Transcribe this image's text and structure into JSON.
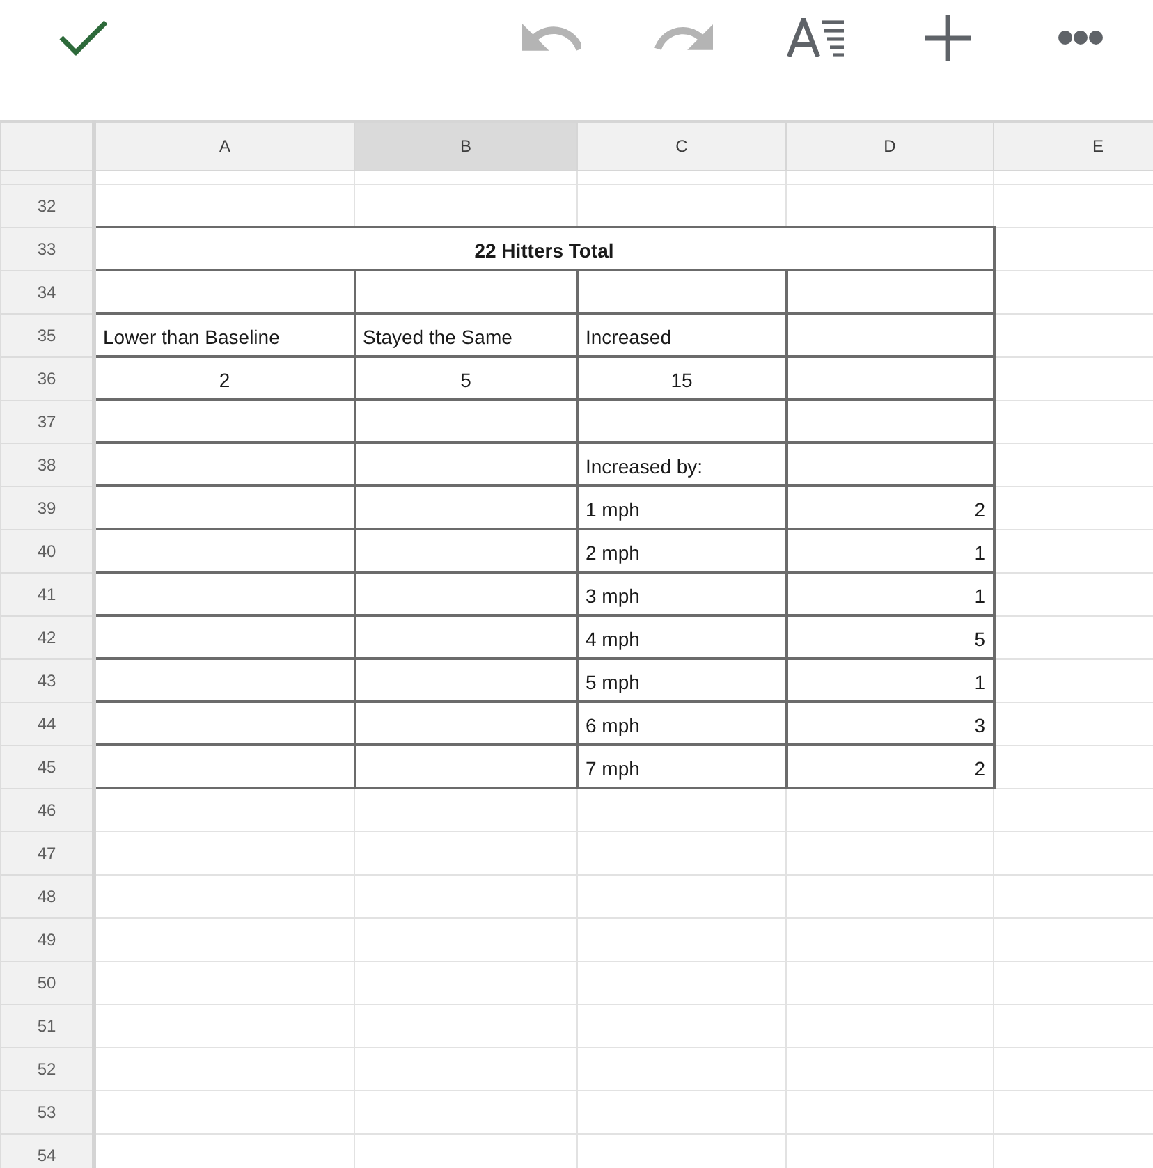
{
  "toolbar": {
    "left": [
      {
        "kind": "check",
        "disabled": false
      }
    ],
    "right": [
      {
        "kind": "undo",
        "disabled": true
      },
      {
        "kind": "redo",
        "disabled": true
      },
      {
        "kind": "text_format",
        "disabled": false
      },
      {
        "kind": "add",
        "disabled": false
      },
      {
        "kind": "more",
        "disabled": false
      }
    ]
  },
  "columns": [
    {
      "label": "A",
      "selected": false
    },
    {
      "label": "B",
      "selected": true
    },
    {
      "label": "C",
      "selected": false
    },
    {
      "label": "D",
      "selected": false
    },
    {
      "label": "E",
      "selected": false
    }
  ],
  "rows": [
    {
      "number": "32",
      "cells": [
        {
          "kind": "empty",
          "bordered": false
        },
        {
          "kind": "empty",
          "bordered": false
        },
        {
          "kind": "empty",
          "bordered": false
        },
        {
          "kind": "empty",
          "bordered": false
        },
        {
          "kind": "empty",
          "bordered": false
        }
      ]
    },
    {
      "number": "33",
      "cells": [
        {
          "kind": "title",
          "text": "22 Hitters Total",
          "bordered": true
        },
        {
          "kind": "empty",
          "bordered": false
        }
      ]
    },
    {
      "number": "34",
      "cells": [
        {
          "kind": "empty",
          "bordered": true
        },
        {
          "kind": "empty",
          "bordered": true
        },
        {
          "kind": "empty",
          "bordered": true
        },
        {
          "kind": "empty",
          "bordered": true
        },
        {
          "kind": "empty",
          "bordered": false
        }
      ]
    },
    {
      "number": "35",
      "cells": [
        {
          "kind": "label",
          "text": "Lower than Baseline",
          "bordered": true
        },
        {
          "kind": "label",
          "text": "Stayed the Same",
          "bordered": true
        },
        {
          "kind": "label",
          "text": "Increased",
          "bordered": true
        },
        {
          "kind": "empty",
          "bordered": true
        },
        {
          "kind": "empty",
          "bordered": false
        }
      ]
    },
    {
      "number": "36",
      "cells": [
        {
          "kind": "total",
          "text": "2",
          "bordered": true
        },
        {
          "kind": "total",
          "text": "5",
          "bordered": true
        },
        {
          "kind": "total",
          "text": "15",
          "bordered": true
        },
        {
          "kind": "empty",
          "bordered": true
        },
        {
          "kind": "empty",
          "bordered": false
        }
      ]
    },
    {
      "number": "37",
      "cells": [
        {
          "kind": "empty",
          "bordered": true
        },
        {
          "kind": "empty",
          "bordered": true
        },
        {
          "kind": "empty",
          "bordered": true
        },
        {
          "kind": "empty",
          "bordered": true
        },
        {
          "kind": "empty",
          "bordered": false
        }
      ]
    },
    {
      "number": "38",
      "cells": [
        {
          "kind": "empty",
          "bordered": true
        },
        {
          "kind": "empty",
          "bordered": true
        },
        {
          "kind": "label",
          "text": "Increased by:",
          "bordered": true
        },
        {
          "kind": "empty",
          "bordered": true
        },
        {
          "kind": "empty",
          "bordered": false
        }
      ]
    },
    {
      "number": "39",
      "cells": [
        {
          "kind": "empty",
          "bordered": true
        },
        {
          "kind": "empty",
          "bordered": true
        },
        {
          "kind": "label",
          "text": "1 mph",
          "bordered": true
        },
        {
          "kind": "count",
          "text": "2",
          "bordered": true
        },
        {
          "kind": "empty",
          "bordered": false
        }
      ]
    },
    {
      "number": "40",
      "cells": [
        {
          "kind": "empty",
          "bordered": true
        },
        {
          "kind": "empty",
          "bordered": true
        },
        {
          "kind": "label",
          "text": "2 mph",
          "bordered": true
        },
        {
          "kind": "count",
          "text": "1",
          "bordered": true
        },
        {
          "kind": "empty",
          "bordered": false
        }
      ]
    },
    {
      "number": "41",
      "cells": [
        {
          "kind": "empty",
          "bordered": true
        },
        {
          "kind": "empty",
          "bordered": true
        },
        {
          "kind": "label",
          "text": "3 mph",
          "bordered": true
        },
        {
          "kind": "count",
          "text": "1",
          "bordered": true
        },
        {
          "kind": "empty",
          "bordered": false
        }
      ]
    },
    {
      "number": "42",
      "cells": [
        {
          "kind": "empty",
          "bordered": true
        },
        {
          "kind": "empty",
          "bordered": true
        },
        {
          "kind": "label",
          "text": "4 mph",
          "bordered": true
        },
        {
          "kind": "count",
          "text": "5",
          "bordered": true
        },
        {
          "kind": "empty",
          "bordered": false
        }
      ]
    },
    {
      "number": "43",
      "cells": [
        {
          "kind": "empty",
          "bordered": true
        },
        {
          "kind": "empty",
          "bordered": true
        },
        {
          "kind": "label",
          "text": "5 mph",
          "bordered": true
        },
        {
          "kind": "count",
          "text": "1",
          "bordered": true
        },
        {
          "kind": "empty",
          "bordered": false
        }
      ]
    },
    {
      "number": "44",
      "cells": [
        {
          "kind": "empty",
          "bordered": true
        },
        {
          "kind": "empty",
          "bordered": true
        },
        {
          "kind": "label",
          "text": "6 mph",
          "bordered": true
        },
        {
          "kind": "count",
          "text": "3",
          "bordered": true
        },
        {
          "kind": "empty",
          "bordered": false
        }
      ]
    },
    {
      "number": "45",
      "cells": [
        {
          "kind": "empty",
          "bordered": true
        },
        {
          "kind": "empty",
          "bordered": true
        },
        {
          "kind": "label",
          "text": "7 mph",
          "bordered": true
        },
        {
          "kind": "count",
          "text": "2",
          "bordered": true
        },
        {
          "kind": "empty",
          "bordered": false
        }
      ]
    },
    {
      "number": "46",
      "cells": [
        {
          "kind": "empty",
          "bordered": false
        },
        {
          "kind": "empty",
          "bordered": false
        },
        {
          "kind": "empty",
          "bordered": false
        },
        {
          "kind": "empty",
          "bordered": false
        },
        {
          "kind": "empty",
          "bordered": false
        }
      ]
    },
    {
      "number": "47",
      "cells": [
        {
          "kind": "empty",
          "bordered": false
        },
        {
          "kind": "empty",
          "bordered": false
        },
        {
          "kind": "empty",
          "bordered": false
        },
        {
          "kind": "empty",
          "bordered": false
        },
        {
          "kind": "empty",
          "bordered": false
        }
      ]
    },
    {
      "number": "48",
      "cells": [
        {
          "kind": "empty",
          "bordered": false
        },
        {
          "kind": "empty",
          "bordered": false
        },
        {
          "kind": "empty",
          "bordered": false
        },
        {
          "kind": "empty",
          "bordered": false
        },
        {
          "kind": "empty",
          "bordered": false
        }
      ]
    },
    {
      "number": "49",
      "cells": [
        {
          "kind": "empty",
          "bordered": false
        },
        {
          "kind": "empty",
          "bordered": false
        },
        {
          "kind": "empty",
          "bordered": false
        },
        {
          "kind": "empty",
          "bordered": false
        },
        {
          "kind": "empty",
          "bordered": false
        }
      ]
    },
    {
      "number": "50",
      "cells": [
        {
          "kind": "empty",
          "bordered": false
        },
        {
          "kind": "empty",
          "bordered": false
        },
        {
          "kind": "empty",
          "bordered": false
        },
        {
          "kind": "empty",
          "bordered": false
        },
        {
          "kind": "empty",
          "bordered": false
        }
      ]
    },
    {
      "number": "51",
      "cells": [
        {
          "kind": "empty",
          "bordered": false
        },
        {
          "kind": "empty",
          "bordered": false
        },
        {
          "kind": "empty",
          "bordered": false
        },
        {
          "kind": "empty",
          "bordered": false
        },
        {
          "kind": "empty",
          "bordered": false
        }
      ]
    },
    {
      "number": "52",
      "cells": [
        {
          "kind": "empty",
          "bordered": false
        },
        {
          "kind": "empty",
          "bordered": false
        },
        {
          "kind": "empty",
          "bordered": false
        },
        {
          "kind": "empty",
          "bordered": false
        },
        {
          "kind": "empty",
          "bordered": false
        }
      ]
    },
    {
      "number": "53",
      "cells": [
        {
          "kind": "empty",
          "bordered": false
        },
        {
          "kind": "empty",
          "bordered": false
        },
        {
          "kind": "empty",
          "bordered": false
        },
        {
          "kind": "empty",
          "bordered": false
        },
        {
          "kind": "empty",
          "bordered": false
        }
      ]
    },
    {
      "number": "54",
      "cells": [
        {
          "kind": "empty",
          "bordered": false
        },
        {
          "kind": "empty",
          "bordered": false
        },
        {
          "kind": "empty",
          "bordered": false
        },
        {
          "kind": "empty",
          "bordered": false
        },
        {
          "kind": "empty",
          "bordered": false
        }
      ]
    }
  ]
}
